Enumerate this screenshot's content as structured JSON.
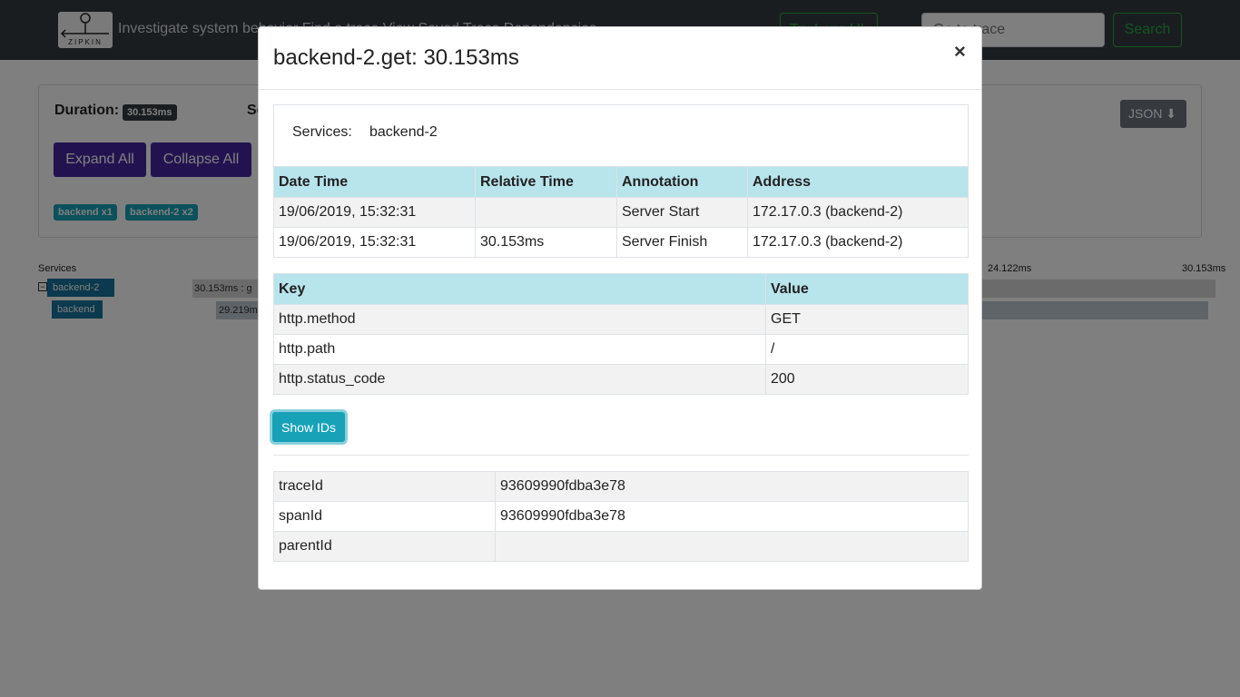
{
  "navbar": {
    "logo_text": "ZIPKIN",
    "tagline": "Investigate system behavior   Find a trace   View Saved Trace   Dependencies",
    "trace_button": "Try Lens UI",
    "search_placeholder": "Go to trace",
    "search_button": "Search"
  },
  "summary": {
    "duration_label": "Duration:",
    "duration_value": "30.153ms",
    "services_label": "Se",
    "expand_all": "Expand All",
    "collapse_all": "Collapse All",
    "json_button": "JSON",
    "service_tags": [
      "backend x1",
      "backend-2 x2"
    ]
  },
  "timeline": {
    "services_header": "Services",
    "time_marks": [
      "24.122ms",
      "30.153ms"
    ],
    "rows": [
      {
        "service": "backend-2",
        "span_text": "30.153ms : g"
      },
      {
        "service": "backend",
        "span_text": "29.219m"
      }
    ]
  },
  "modal": {
    "title": "backend-2.get: 30.153ms",
    "close": "×",
    "services_label": "Services:",
    "services_value": "backend-2",
    "annotations": {
      "headers": [
        "Date Time",
        "Relative Time",
        "Annotation",
        "Address"
      ],
      "rows": [
        [
          "19/06/2019, 15:32:31",
          "",
          "Server Start",
          "172.17.0.3 (backend-2)"
        ],
        [
          "19/06/2019, 15:32:31",
          "30.153ms",
          "Server Finish",
          "172.17.0.3 (backend-2)"
        ]
      ]
    },
    "tags": {
      "headers": [
        "Key",
        "Value"
      ],
      "rows": [
        [
          "http.method",
          "GET"
        ],
        [
          "http.path",
          "/"
        ],
        [
          "http.status_code",
          "200"
        ]
      ]
    },
    "show_ids_button": "Show IDs",
    "ids": {
      "rows": [
        [
          "traceId",
          "93609990fdba3e78"
        ],
        [
          "spanId",
          "93609990fdba3e78"
        ],
        [
          "parentId",
          ""
        ]
      ]
    }
  },
  "colors": {
    "navbar": "#343a40",
    "accent_green": "#28a745",
    "purple_button": "#4527a0",
    "teal": "#17a2b8",
    "table_header": "#b8e4ec"
  }
}
